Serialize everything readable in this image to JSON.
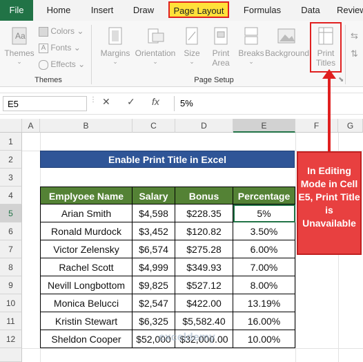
{
  "ribbon": {
    "tabs": [
      "File",
      "Home",
      "Insert",
      "Draw",
      "Page Layout",
      "Formulas",
      "Data",
      "Review"
    ],
    "selected_tab": "Page Layout",
    "themes": {
      "button": "Themes",
      "colors": "Colors",
      "fonts": "Fonts",
      "effects": "Effects",
      "group": "Themes"
    },
    "page_setup": {
      "margins": "Margins",
      "orientation": "Orientation",
      "size": "Size",
      "print_area_1": "Print",
      "print_area_2": "Area",
      "breaks": "Breaks",
      "background": "Background",
      "print_titles_1": "Print",
      "print_titles_2": "Titles",
      "group": "Page Setup"
    }
  },
  "formula_bar": {
    "name_box": "E5",
    "cancel": "✕",
    "enter": "✓",
    "fx": "fx",
    "value": "5%"
  },
  "columns": [
    "A",
    "B",
    "C",
    "D",
    "E",
    "F",
    "G"
  ],
  "rows": [
    "1",
    "2",
    "3",
    "4",
    "5",
    "6",
    "7",
    "8",
    "9",
    "10",
    "11",
    "12"
  ],
  "sheet": {
    "title": "Enable Print Title in Excel",
    "headers": [
      "Emplyoee Name",
      "Salary",
      "Bonus",
      "Percentage"
    ],
    "data": [
      [
        "Arian Smith",
        "$4,598",
        "$228.35",
        "5%"
      ],
      [
        "Ronald Murdock",
        "$3,452",
        "$120.82",
        "3.50%"
      ],
      [
        "Victor Zelensky",
        "$6,574",
        "$275.28",
        "6.00%"
      ],
      [
        "Rachel Scott",
        "$4,999",
        "$349.93",
        "7.00%"
      ],
      [
        "Nevill Longbottom",
        "$9,825",
        "$527.12",
        "8.00%"
      ],
      [
        "Monica Belucci",
        "$2,547",
        "$422.00",
        "13.19%"
      ],
      [
        "Kristin Stewart",
        "$6,325",
        "$5,582.40",
        "16.00%"
      ],
      [
        "Sheldon Cooper",
        "$52,000",
        "$32,000.00",
        "10.00%"
      ]
    ]
  },
  "annotation": {
    "text": "In Editing Mode in Cell E5, Print Title is Unavailable"
  },
  "watermark": "exceldemy",
  "colors": {
    "header_green": "#548235",
    "title_blue": "#2f5597",
    "callout_red": "#e84040",
    "excel_green": "#217346",
    "highlight_yellow": "#ffe13a"
  }
}
